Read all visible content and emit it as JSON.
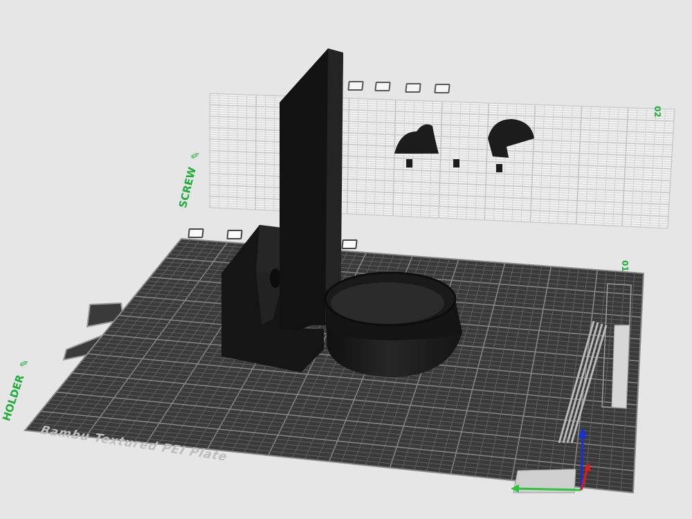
{
  "plates": [
    {
      "number": "01",
      "name": "HOLDER",
      "bed_label": "Bambu Textured PEI Plate",
      "active": true
    },
    {
      "number": "02",
      "name": "SCREW",
      "active": false
    }
  ],
  "icons": {
    "edit": "edit-pencil-icon",
    "plate_tools": [
      "delete-plate-icon",
      "arrange-icon",
      "orient-icon",
      "lock-icon",
      "settings-icon"
    ]
  },
  "colors": {
    "background": "#e6e6e6",
    "bed_dark": "#3a3a3a",
    "bed_grid": "#6e6e6e",
    "plate_label": "#1fae3a",
    "model": "#1c1c1c",
    "axis_x": "#2bc43b",
    "axis_y": "#e11b1b",
    "axis_z": "#1530e0"
  }
}
